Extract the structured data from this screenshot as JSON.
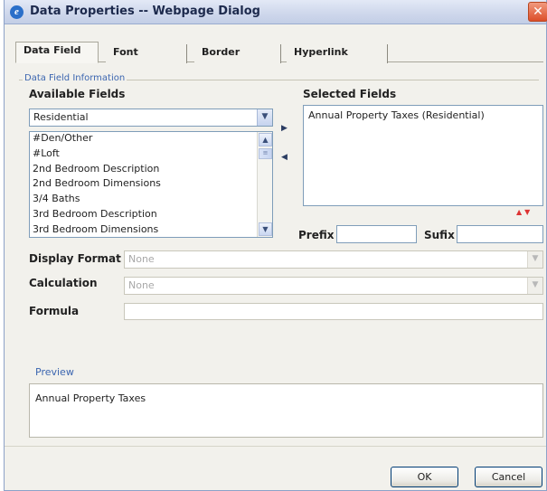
{
  "window": {
    "title": "Data Properties -- Webpage Dialog",
    "close_symbol": "✕"
  },
  "tabs": [
    {
      "label": "Data Field",
      "active": true
    },
    {
      "label": "Font",
      "active": false
    },
    {
      "label": "Border",
      "active": false
    },
    {
      "label": "Hyperlink",
      "active": false
    }
  ],
  "group": {
    "label": "Data Field Information"
  },
  "available_fields": {
    "label": "Available Fields",
    "category_value": "Residential",
    "items": [
      "#Den/Other",
      "#Loft",
      "2nd Bedroom Description",
      "2nd Bedroom Dimensions",
      "3/4 Baths",
      "3rd Bedroom Description",
      "3rd Bedroom Dimensions"
    ]
  },
  "transfer": {
    "add_symbol": "▶",
    "remove_symbol": "◀"
  },
  "selected_fields": {
    "label": "Selected Fields",
    "items": [
      "Annual Property Taxes (Residential)"
    ],
    "move_up_symbol": "▲",
    "move_down_symbol": "▼"
  },
  "prefix": {
    "label": "Prefix",
    "value": ""
  },
  "suffix": {
    "label": "Sufix",
    "value": ""
  },
  "display_format": {
    "label": "Display Format",
    "value": "None"
  },
  "calculation": {
    "label": "Calculation",
    "value": "None"
  },
  "formula": {
    "label": "Formula",
    "value": ""
  },
  "preview": {
    "label": "Preview",
    "text": "Annual Property Taxes"
  },
  "footer": {
    "ok_label": "OK",
    "cancel_label": "Cancel"
  },
  "icons": {
    "dropdown_symbol": "▼",
    "scroll_up_symbol": "▲",
    "scroll_down_symbol": "▼",
    "thumb_grip_symbol": "≡"
  }
}
